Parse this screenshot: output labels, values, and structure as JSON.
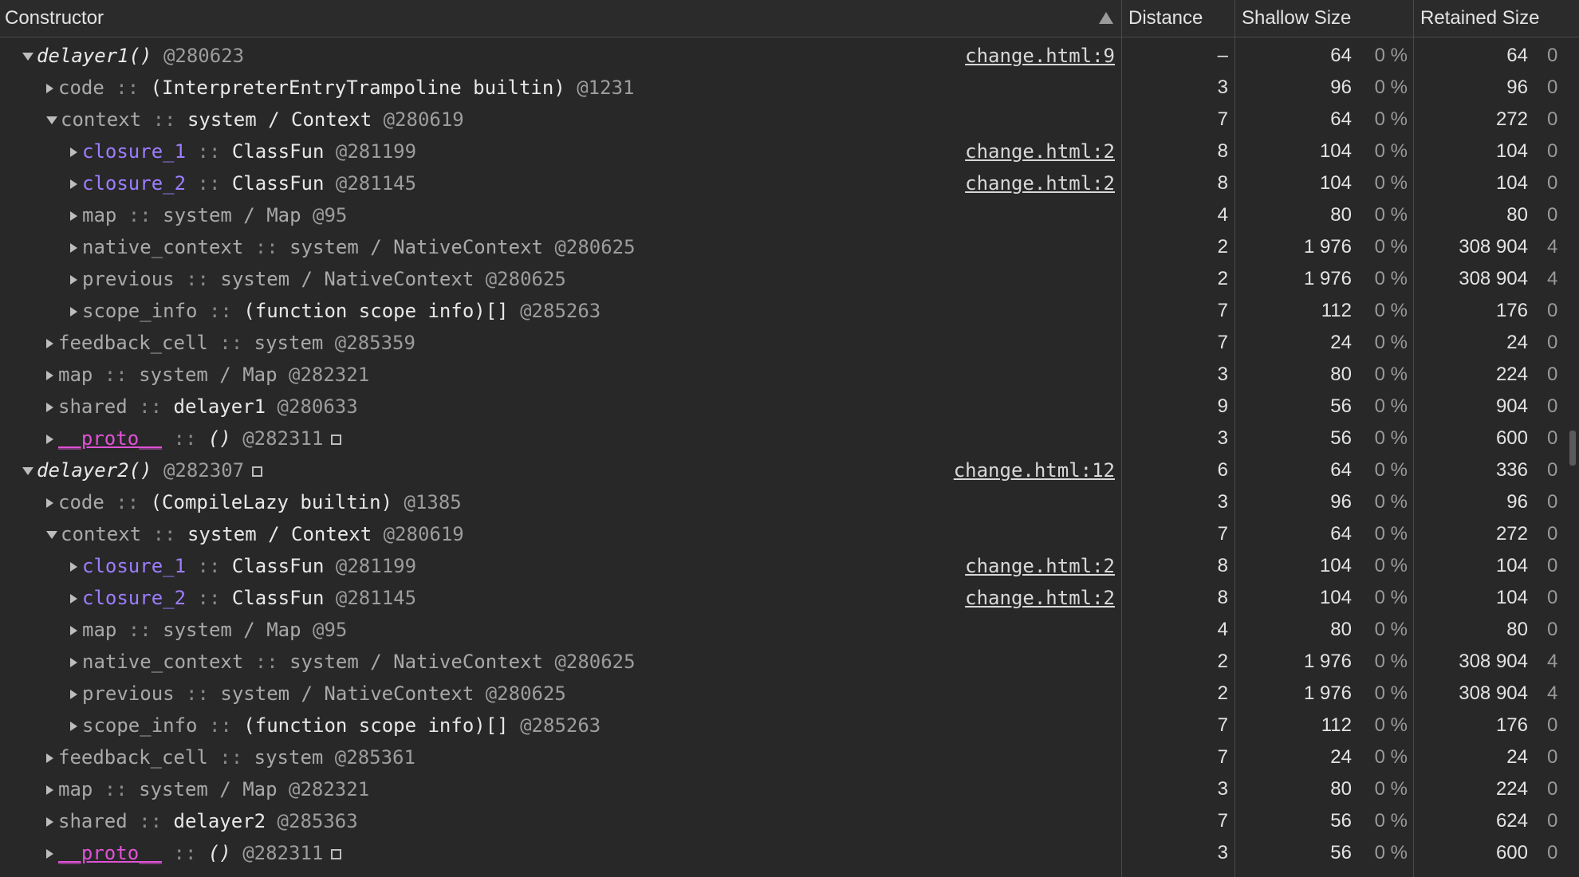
{
  "header": {
    "constructor": "Constructor",
    "distance": "Distance",
    "shallow_size": "Shallow Size",
    "retained_size": "Retained Size"
  },
  "colors": {
    "background": "#282828",
    "closure_link": "#9d7dff",
    "proto": "#e052d6"
  },
  "rows": [
    {
      "indent": 0,
      "toggle": "down",
      "name": "delayer1()",
      "name_style": "ital",
      "sep": "",
      "type": "",
      "type_style": "",
      "id": "@280623",
      "box": false,
      "link": "change.html:9",
      "distance": "–",
      "shallow": "64",
      "shallow_pct": "0 %",
      "retained": "64",
      "retained_pct": "0"
    },
    {
      "indent": 1,
      "toggle": "right",
      "name": "code",
      "name_style": "grey",
      "sep": " :: ",
      "type": "(InterpreterEntryTrampoline builtin)",
      "type_style": "",
      "id": "@1231",
      "box": false,
      "link": "",
      "distance": "3",
      "shallow": "96",
      "shallow_pct": "0 %",
      "retained": "96",
      "retained_pct": "0"
    },
    {
      "indent": 1,
      "toggle": "down",
      "name": "context",
      "name_style": "grey",
      "sep": " :: ",
      "type": "system / Context",
      "type_style": "",
      "id": "@280619",
      "box": false,
      "link": "",
      "distance": "7",
      "shallow": "64",
      "shallow_pct": "0 %",
      "retained": "272",
      "retained_pct": "0"
    },
    {
      "indent": 2,
      "toggle": "right",
      "name": "closure_1",
      "name_style": "link",
      "sep": " :: ",
      "type": "ClassFun",
      "type_style": "",
      "id": "@281199",
      "box": false,
      "link": "change.html:2",
      "distance": "8",
      "shallow": "104",
      "shallow_pct": "0 %",
      "retained": "104",
      "retained_pct": "0"
    },
    {
      "indent": 2,
      "toggle": "right",
      "name": "closure_2",
      "name_style": "link",
      "sep": " :: ",
      "type": "ClassFun",
      "type_style": "",
      "id": "@281145",
      "box": false,
      "link": "change.html:2",
      "distance": "8",
      "shallow": "104",
      "shallow_pct": "0 %",
      "retained": "104",
      "retained_pct": "0"
    },
    {
      "indent": 2,
      "toggle": "right",
      "name": "map",
      "name_style": "grey",
      "sep": " :: ",
      "type": "system / Map",
      "type_style": "grey",
      "id": "@95",
      "box": false,
      "link": "",
      "distance": "4",
      "shallow": "80",
      "shallow_pct": "0 %",
      "retained": "80",
      "retained_pct": "0"
    },
    {
      "indent": 2,
      "toggle": "right",
      "name": "native_context",
      "name_style": "grey",
      "sep": " :: ",
      "type": "system / NativeContext",
      "type_style": "grey",
      "id": "@280625",
      "box": false,
      "link": "",
      "distance": "2",
      "shallow": "1 976",
      "shallow_pct": "0 %",
      "retained": "308 904",
      "retained_pct": "4"
    },
    {
      "indent": 2,
      "toggle": "right",
      "name": "previous",
      "name_style": "grey",
      "sep": " :: ",
      "type": "system / NativeContext",
      "type_style": "grey",
      "id": "@280625",
      "box": false,
      "link": "",
      "distance": "2",
      "shallow": "1 976",
      "shallow_pct": "0 %",
      "retained": "308 904",
      "retained_pct": "4"
    },
    {
      "indent": 2,
      "toggle": "right",
      "name": "scope_info",
      "name_style": "grey",
      "sep": " :: ",
      "type": "(function scope info)[]",
      "type_style": "",
      "id": "@285263",
      "box": false,
      "link": "",
      "distance": "7",
      "shallow": "112",
      "shallow_pct": "0 %",
      "retained": "176",
      "retained_pct": "0"
    },
    {
      "indent": 1,
      "toggle": "right",
      "name": "feedback_cell",
      "name_style": "grey",
      "sep": " :: ",
      "type": "system",
      "type_style": "grey",
      "id": "@285359",
      "box": false,
      "link": "",
      "distance": "7",
      "shallow": "24",
      "shallow_pct": "0 %",
      "retained": "24",
      "retained_pct": "0"
    },
    {
      "indent": 1,
      "toggle": "right",
      "name": "map",
      "name_style": "grey",
      "sep": " :: ",
      "type": "system / Map",
      "type_style": "grey",
      "id": "@282321",
      "box": false,
      "link": "",
      "distance": "3",
      "shallow": "80",
      "shallow_pct": "0 %",
      "retained": "224",
      "retained_pct": "0"
    },
    {
      "indent": 1,
      "toggle": "right",
      "name": "shared",
      "name_style": "grey",
      "sep": " :: ",
      "type": "delayer1",
      "type_style": "",
      "id": "@280633",
      "box": false,
      "link": "",
      "distance": "9",
      "shallow": "56",
      "shallow_pct": "0 %",
      "retained": "904",
      "retained_pct": "0"
    },
    {
      "indent": 1,
      "toggle": "right",
      "name": "__proto__",
      "name_style": "pink",
      "sep": " :: ",
      "type": "()",
      "type_style": "ital",
      "id": "@282311",
      "box": true,
      "link": "",
      "distance": "3",
      "shallow": "56",
      "shallow_pct": "0 %",
      "retained": "600",
      "retained_pct": "0"
    },
    {
      "indent": 0,
      "toggle": "down",
      "name": "delayer2()",
      "name_style": "ital",
      "sep": "",
      "type": "",
      "type_style": "",
      "id": "@282307",
      "box": true,
      "link": "change.html:12",
      "distance": "6",
      "shallow": "64",
      "shallow_pct": "0 %",
      "retained": "336",
      "retained_pct": "0"
    },
    {
      "indent": 1,
      "toggle": "right",
      "name": "code",
      "name_style": "grey",
      "sep": " :: ",
      "type": "(CompileLazy builtin)",
      "type_style": "",
      "id": "@1385",
      "box": false,
      "link": "",
      "distance": "3",
      "shallow": "96",
      "shallow_pct": "0 %",
      "retained": "96",
      "retained_pct": "0"
    },
    {
      "indent": 1,
      "toggle": "down",
      "name": "context",
      "name_style": "grey",
      "sep": " :: ",
      "type": "system / Context",
      "type_style": "",
      "id": "@280619",
      "box": false,
      "link": "",
      "distance": "7",
      "shallow": "64",
      "shallow_pct": "0 %",
      "retained": "272",
      "retained_pct": "0"
    },
    {
      "indent": 2,
      "toggle": "right",
      "name": "closure_1",
      "name_style": "link",
      "sep": " :: ",
      "type": "ClassFun",
      "type_style": "",
      "id": "@281199",
      "box": false,
      "link": "change.html:2",
      "distance": "8",
      "shallow": "104",
      "shallow_pct": "0 %",
      "retained": "104",
      "retained_pct": "0"
    },
    {
      "indent": 2,
      "toggle": "right",
      "name": "closure_2",
      "name_style": "link",
      "sep": " :: ",
      "type": "ClassFun",
      "type_style": "",
      "id": "@281145",
      "box": false,
      "link": "change.html:2",
      "distance": "8",
      "shallow": "104",
      "shallow_pct": "0 %",
      "retained": "104",
      "retained_pct": "0"
    },
    {
      "indent": 2,
      "toggle": "right",
      "name": "map",
      "name_style": "grey",
      "sep": " :: ",
      "type": "system / Map",
      "type_style": "grey",
      "id": "@95",
      "box": false,
      "link": "",
      "distance": "4",
      "shallow": "80",
      "shallow_pct": "0 %",
      "retained": "80",
      "retained_pct": "0"
    },
    {
      "indent": 2,
      "toggle": "right",
      "name": "native_context",
      "name_style": "grey",
      "sep": " :: ",
      "type": "system / NativeContext",
      "type_style": "grey",
      "id": "@280625",
      "box": false,
      "link": "",
      "distance": "2",
      "shallow": "1 976",
      "shallow_pct": "0 %",
      "retained": "308 904",
      "retained_pct": "4"
    },
    {
      "indent": 2,
      "toggle": "right",
      "name": "previous",
      "name_style": "grey",
      "sep": " :: ",
      "type": "system / NativeContext",
      "type_style": "grey",
      "id": "@280625",
      "box": false,
      "link": "",
      "distance": "2",
      "shallow": "1 976",
      "shallow_pct": "0 %",
      "retained": "308 904",
      "retained_pct": "4"
    },
    {
      "indent": 2,
      "toggle": "right",
      "name": "scope_info",
      "name_style": "grey",
      "sep": " :: ",
      "type": "(function scope info)[]",
      "type_style": "",
      "id": "@285263",
      "box": false,
      "link": "",
      "distance": "7",
      "shallow": "112",
      "shallow_pct": "0 %",
      "retained": "176",
      "retained_pct": "0"
    },
    {
      "indent": 1,
      "toggle": "right",
      "name": "feedback_cell",
      "name_style": "grey",
      "sep": " :: ",
      "type": "system",
      "type_style": "grey",
      "id": "@285361",
      "box": false,
      "link": "",
      "distance": "7",
      "shallow": "24",
      "shallow_pct": "0 %",
      "retained": "24",
      "retained_pct": "0"
    },
    {
      "indent": 1,
      "toggle": "right",
      "name": "map",
      "name_style": "grey",
      "sep": " :: ",
      "type": "system / Map",
      "type_style": "grey",
      "id": "@282321",
      "box": false,
      "link": "",
      "distance": "3",
      "shallow": "80",
      "shallow_pct": "0 %",
      "retained": "224",
      "retained_pct": "0"
    },
    {
      "indent": 1,
      "toggle": "right",
      "name": "shared",
      "name_style": "grey",
      "sep": " :: ",
      "type": "delayer2",
      "type_style": "",
      "id": "@285363",
      "box": false,
      "link": "",
      "distance": "7",
      "shallow": "56",
      "shallow_pct": "0 %",
      "retained": "624",
      "retained_pct": "0"
    },
    {
      "indent": 1,
      "toggle": "right",
      "name": "__proto__",
      "name_style": "pink",
      "sep": " :: ",
      "type": "()",
      "type_style": "ital",
      "id": "@282311",
      "box": true,
      "link": "",
      "distance": "3",
      "shallow": "56",
      "shallow_pct": "0 %",
      "retained": "600",
      "retained_pct": "0"
    }
  ]
}
